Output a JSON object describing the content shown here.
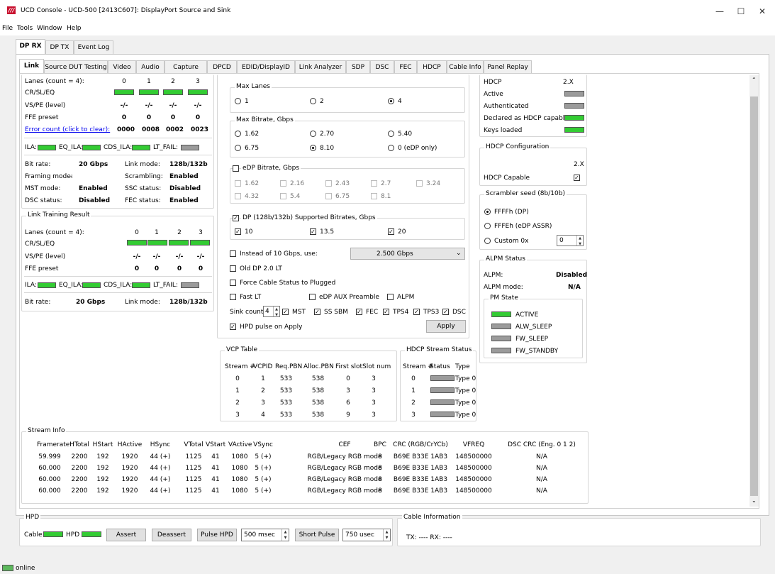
{
  "window": {
    "title": "UCD Console - UCD-500 [2413C607]: DisplayPort Source and Sink",
    "icon_text": "///"
  },
  "menu": [
    "File",
    "Tools",
    "Window",
    "Help"
  ],
  "main_tabs": [
    "DP RX",
    "DP TX",
    "Event Log"
  ],
  "sub_tabs": [
    "Link",
    "Source DUT Testing",
    "Video",
    "Audio",
    "Capture",
    "DPCD",
    "EDID/DisplayID",
    "Link Analyzer",
    "SDP",
    "DSC",
    "FEC",
    "HDCP",
    "Cable Info",
    "Panel Replay"
  ],
  "link": {
    "lanes_label": "Lanes (count = 4):",
    "lane_nums": [
      "0",
      "1",
      "2",
      "3"
    ],
    "crsleq": "CR/SL/EQ",
    "vspe": "VS/PE (level)",
    "vspe_vals": [
      "-/-",
      "-/-",
      "-/-",
      "-/-"
    ],
    "ffe": "FFE preset",
    "ffe_vals": [
      "0",
      "0",
      "0",
      "0"
    ],
    "error_label": "Error count (click to clear):",
    "error_vals": [
      "0000",
      "0008",
      "0002",
      "0023"
    ],
    "ila": "ILA:",
    "eq_ila": "EQ_ILA:",
    "cds_ila": "CDS_ILA:",
    "lt_fail": "LT_FAIL:",
    "bitrate_l": "Bit rate:",
    "bitrate_v": "20 Gbps",
    "linkmode_l": "Link mode:",
    "linkmode_v": "128b/132b",
    "framing_l": "Framing mode:",
    "framing_v": "-",
    "scram_l": "Scrambling:",
    "scram_v": "Enabled",
    "mst_l": "MST mode:",
    "mst_v": "Enabled",
    "ssc_l": "SSC status:",
    "ssc_v": "Disabled",
    "dsc_l": "DSC status:",
    "dsc_v": "Disabled",
    "fec_l": "FEC status:",
    "fec_v": "Enabled"
  },
  "ltr": {
    "title": "Link Training Result",
    "lanes_label": "Lanes (count = 4):",
    "lane_nums": [
      "0",
      "1",
      "2",
      "3"
    ],
    "crsleq": "CR/SL/EQ",
    "vspe": "VS/PE (level)",
    "vspe_vals": [
      "-/-",
      "-/-",
      "-/-",
      "-/-"
    ],
    "ffe": "FFE preset",
    "ffe_vals": [
      "0",
      "0",
      "0",
      "0"
    ],
    "ila": "ILA:",
    "eq_ila": "EQ_ILA:",
    "cds_ila": "CDS_ILA:",
    "lt_fail": "LT_FAIL:",
    "bitrate_l": "Bit rate:",
    "bitrate_v": "20 Gbps",
    "linkmode_l": "Link mode:",
    "linkmode_v": "128b/132b"
  },
  "maxlanes": {
    "title": "Max Lanes",
    "opts": [
      "1",
      "2",
      "4"
    ]
  },
  "maxbitrate": {
    "title": "Max Bitrate, Gbps",
    "opts": [
      "1.62",
      "2.70",
      "5.40",
      "6.75",
      "8.10",
      "0 (eDP only)"
    ]
  },
  "edp": {
    "title": "eDP Bitrate, Gbps",
    "opts": [
      "1.62",
      "2.16",
      "2.43",
      "2.7",
      "3.24",
      "4.32",
      "5.4",
      "6.75",
      "8.1"
    ]
  },
  "dp128": {
    "title": "DP (128b/132b) Supported Bitrates, Gbps",
    "opts": [
      "10",
      "13.5",
      "20"
    ]
  },
  "opts": {
    "instead": "Instead of 10 Gbps, use:",
    "instead_val": "2.500 Gbps",
    "olddp": "Old DP 2.0 LT",
    "force": "Force Cable Status to Plugged",
    "fastlt": "Fast LT",
    "edpaux": "eDP AUX Preamble",
    "alpm": "ALPM",
    "sink": "Sink count:",
    "sink_val": "4",
    "mst": "MST",
    "sssbm": "SS SBM",
    "fec": "FEC",
    "tps4": "TPS4",
    "tps3": "TPS3",
    "dsc": "DSC",
    "hpdpulse": "HPD pulse on Apply",
    "apply": "Apply"
  },
  "vcp": {
    "title": "VCP Table",
    "headers": [
      "Stream #",
      "VCPID",
      "Req.PBN",
      "Alloc.PBN",
      "First slot",
      "Slot num"
    ],
    "rows": [
      [
        "0",
        "1",
        "533",
        "538",
        "0",
        "3"
      ],
      [
        "1",
        "2",
        "533",
        "538",
        "3",
        "3"
      ],
      [
        "2",
        "3",
        "533",
        "538",
        "6",
        "3"
      ],
      [
        "3",
        "4",
        "533",
        "538",
        "9",
        "3"
      ]
    ]
  },
  "hdcpstream": {
    "title": "HDCP Stream Status",
    "headers": [
      "Stream #",
      "Status",
      "Type"
    ],
    "rows": [
      [
        "0",
        "Type 0"
      ],
      [
        "1",
        "Type 0"
      ],
      [
        "2",
        "Type 0"
      ],
      [
        "3",
        "Type 0"
      ]
    ]
  },
  "hdcp": {
    "h": "HDCP",
    "hv": "2.X",
    "active": "Active",
    "auth": "Authenticated",
    "declared": "Declared as HDCP capable",
    "keys": "Keys loaded"
  },
  "hdcpconf": {
    "title": "HDCP Configuration",
    "ver": "2.X",
    "capable": "HDCP Capable"
  },
  "scrambler": {
    "title": "Scrambler seed (8b/10b)",
    "o1": "FFFFh (DP)",
    "o2": "FFFEh (eDP ASSR)",
    "o3": "Custom 0x",
    "custom_val": "0"
  },
  "alpmstatus": {
    "title": "ALPM Status",
    "alpm_l": "ALPM:",
    "alpm_v": "Disabled",
    "mode_l": "ALPM mode:",
    "mode_v": "N/A"
  },
  "pmstate": {
    "title": "PM State",
    "items": [
      "ACTIVE",
      "ALW_SLEEP",
      "FW_SLEEP",
      "FW_STANDBY"
    ]
  },
  "streaminfo": {
    "title": "Stream Info",
    "headers": [
      "Framerate",
      "HTotal",
      "HStart",
      "HActive",
      "HSync",
      "VTotal",
      "VStart",
      "VActive",
      "VSync",
      "CEF",
      "BPC",
      "CRC (RGB/CrYCb)",
      "VFREQ",
      "DSC CRC (Eng. 0 1 2)"
    ],
    "rows": [
      [
        "59.999",
        "2200",
        "192",
        "1920",
        "44 (+)",
        "1125",
        "41",
        "1080",
        "5 (+)",
        "RGB/Legacy RGB mode",
        "8",
        "B69E B33E 1AB3",
        "148500000",
        "N/A"
      ],
      [
        "60.000",
        "2200",
        "192",
        "1920",
        "44 (+)",
        "1125",
        "41",
        "1080",
        "5 (+)",
        "RGB/Legacy RGB mode",
        "8",
        "B69E B33E 1AB3",
        "148500000",
        "N/A"
      ],
      [
        "60.000",
        "2200",
        "192",
        "1920",
        "44 (+)",
        "1125",
        "41",
        "1080",
        "5 (+)",
        "RGB/Legacy RGB mode",
        "8",
        "B69E B33E 1AB3",
        "148500000",
        "N/A"
      ],
      [
        "60.000",
        "2200",
        "192",
        "1920",
        "44 (+)",
        "1125",
        "41",
        "1080",
        "5 (+)",
        "RGB/Legacy RGB mode",
        "8",
        "B69E B33E 1AB3",
        "148500000",
        "N/A"
      ]
    ]
  },
  "hpd": {
    "title": "HPD",
    "cable": "Cable",
    "hpd": "HPD",
    "assert": "Assert",
    "deassert": "Deassert",
    "pulse": "Pulse HPD",
    "pulse_val": "500 msec",
    "short": "Short Pulse",
    "short_val": "750 usec"
  },
  "cableinfo": {
    "title": "Cable Information",
    "text": "TX: ---- RX: ----"
  },
  "status": {
    "text": "online"
  }
}
